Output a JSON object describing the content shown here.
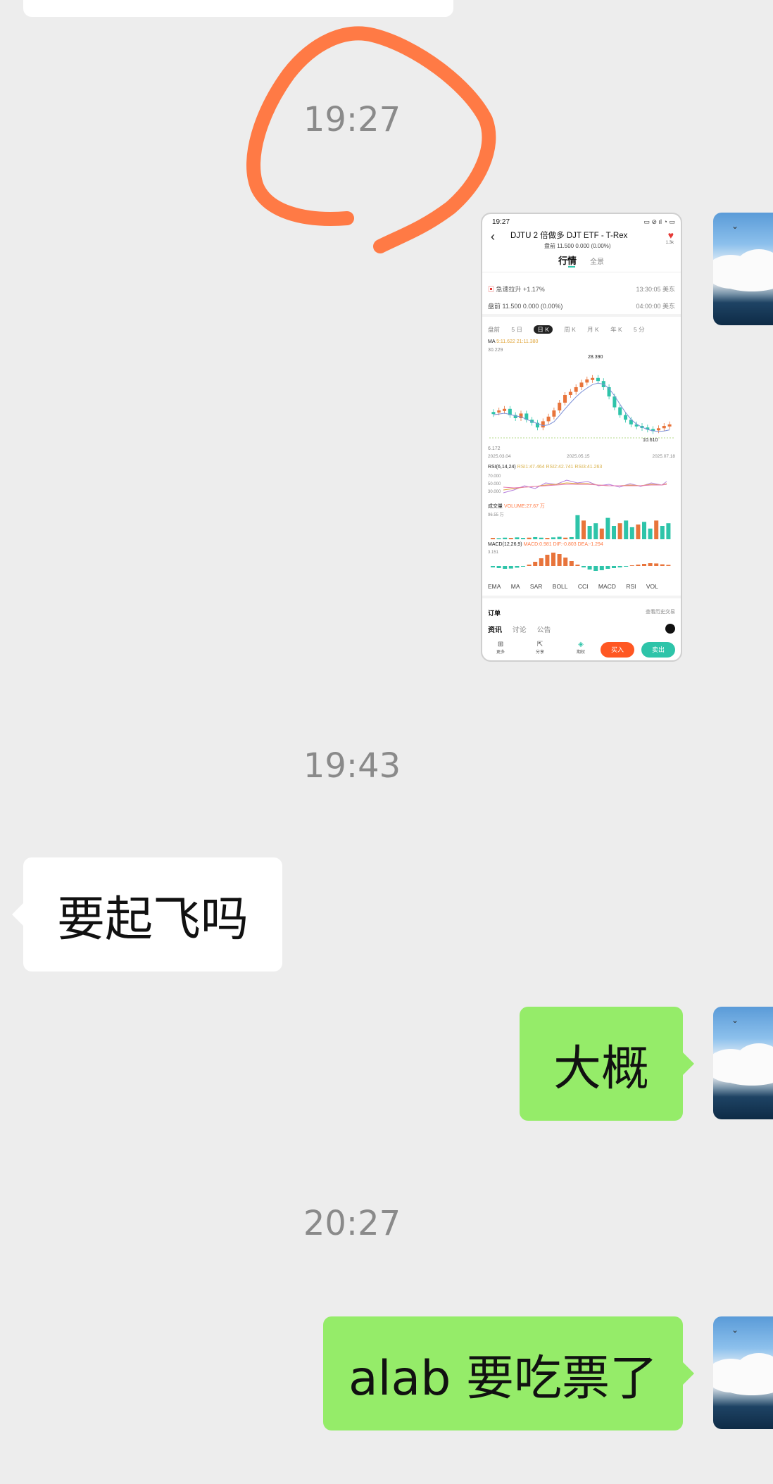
{
  "timestamps": [
    "19:27",
    "19:43",
    "20:27"
  ],
  "messages": [
    {
      "side": "in",
      "text": "要起飞吗"
    },
    {
      "side": "out",
      "text": "大概"
    },
    {
      "side": "out",
      "text": "alab 要吃票了"
    }
  ],
  "annotation_color": "#ff7a45",
  "thumbnail": {
    "status_time": "19:27",
    "stock_title": "DJTU 2 倍做多 DJT ETF - T-Rex",
    "stock_sub": "盘前 11.500 0.000 (0.00%)",
    "tab_active": "行情",
    "tab_other": "全景",
    "fav_count": "1.3k",
    "alert_text": "急速拉升 +1.17%",
    "alert_time": "13:30:05 美东",
    "premarket_text": "盘前 11.500 0.000 (0.00%)",
    "premarket_time": "04:00:00 美东",
    "period_tabs": [
      "盘前",
      "5 日",
      "日 K",
      "周 K",
      "月 K",
      "年 K",
      "5 分"
    ],
    "period_active": "日 K",
    "ma_label": "MA",
    "ma_values": "5:11.622  21:11.380",
    "y_high": "30.229",
    "peak_label": "28.390",
    "low_label": "10.610",
    "y_low": "6.172",
    "date_start": "2025.03.04",
    "date_mid": "2025.05.15",
    "date_end": "2025.07.18",
    "rsi_label": "RSI(6,14,24)",
    "rsi_values": "RSI1:47.464  RSI2:42.741  RSI3:41.263",
    "rsi_levels": [
      "70.000",
      "50.000",
      "30.000"
    ],
    "vol_label": "成交量",
    "vol_value": "VOLUME:27.67 万",
    "vol_max": "96.55 万",
    "macd_label": "MACD(12,26,9)",
    "macd_values": "MACD:0.981  DIF:-0.803  DEA:-1.294",
    "macd_max": "3.151",
    "indicators": [
      "EMA",
      "MA",
      "SAR",
      "BOLL",
      "CCI",
      "MACD",
      "RSI",
      "VOL"
    ],
    "orders_label": "订单",
    "orders_link": "查看历史交易",
    "news_tabs": [
      "资讯",
      "讨论",
      "公告"
    ],
    "nav": [
      "更多",
      "分享",
      "期权"
    ],
    "buy": "买入",
    "sell": "卖出",
    "buy_color": "#ff5722",
    "sell_color": "#2ec4a9"
  }
}
